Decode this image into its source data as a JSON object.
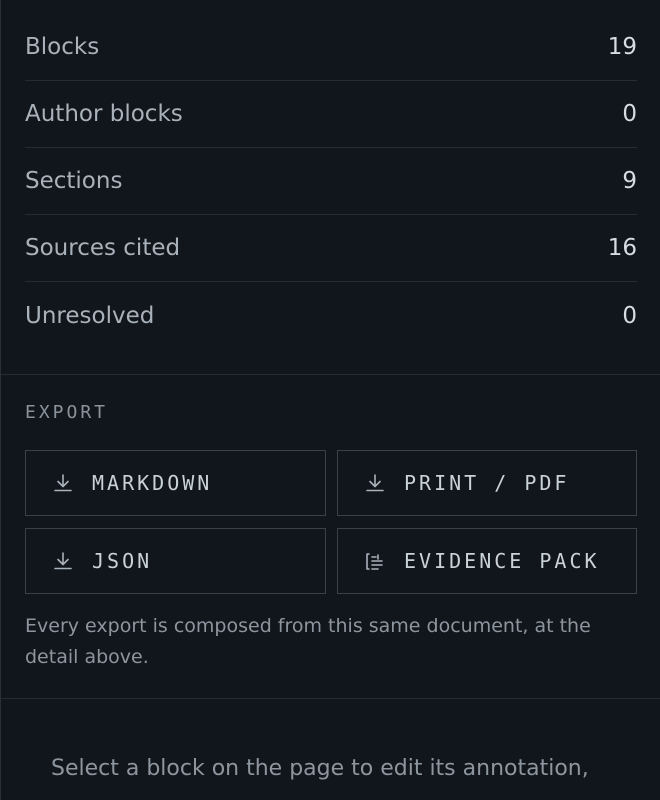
{
  "stats": [
    {
      "label": "Blocks",
      "value": "19"
    },
    {
      "label": "Author blocks",
      "value": "0"
    },
    {
      "label": "Sections",
      "value": "9"
    },
    {
      "label": "Sources cited",
      "value": "16"
    },
    {
      "label": "Unresolved",
      "value": "0"
    }
  ],
  "export": {
    "heading": "EXPORT",
    "buttons": [
      {
        "label": "MARKDOWN",
        "icon": "download-icon"
      },
      {
        "label": "PRINT / PDF",
        "icon": "download-icon"
      },
      {
        "label": "JSON",
        "icon": "download-icon"
      },
      {
        "label": "EVIDENCE PACK",
        "icon": "document-list-icon"
      }
    ],
    "note": "Every export is composed from this same document, at the detail above."
  },
  "hint": "Select a block on the page to edit its annotation,"
}
